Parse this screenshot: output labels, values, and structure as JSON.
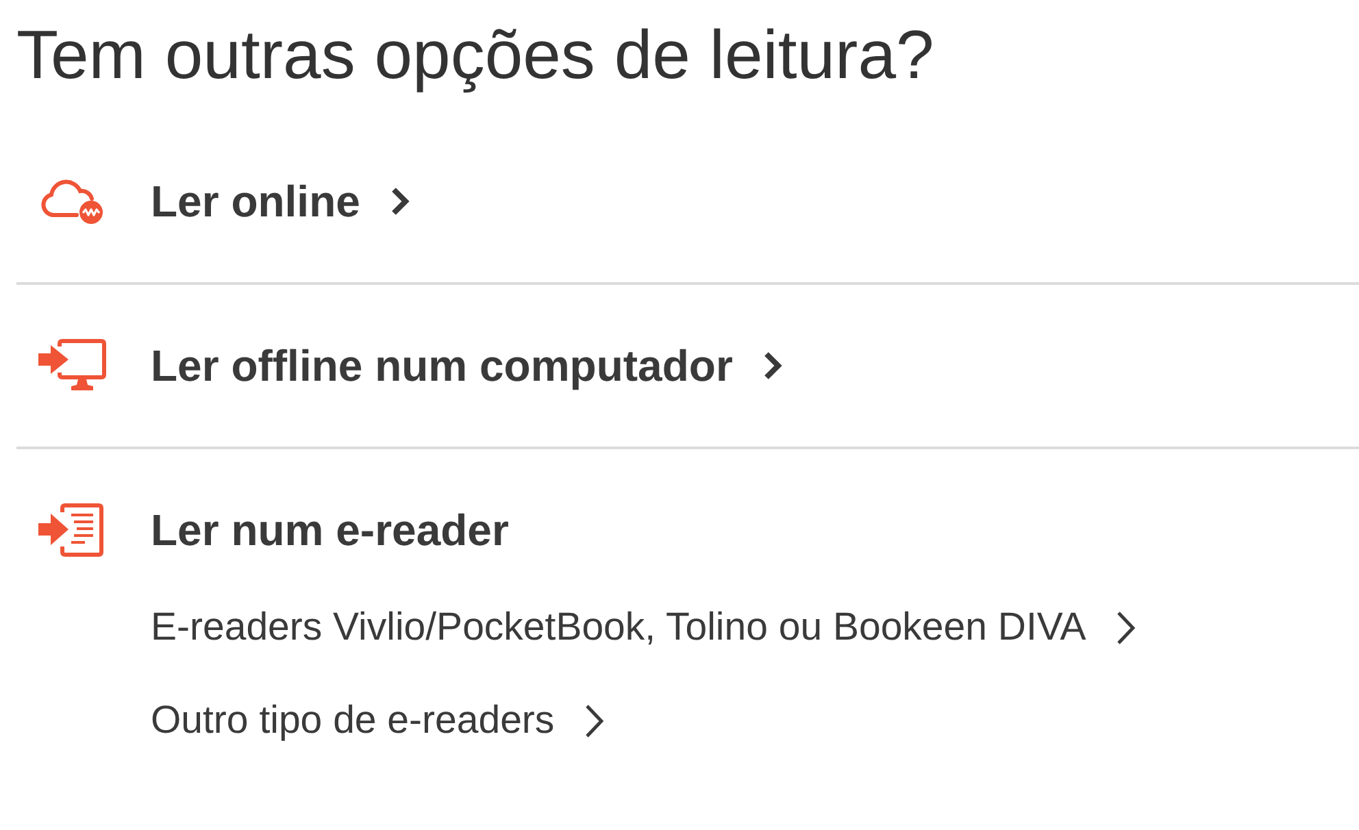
{
  "heading": "Tem outras opções de leitura?",
  "options": [
    {
      "kind": "link",
      "label": "Ler online"
    },
    {
      "kind": "link",
      "label": "Ler offline num computador"
    },
    {
      "kind": "group",
      "label": "Ler num e-reader",
      "links": [
        "E-readers Vivlio/PocketBook, Tolino ou Bookeen DIVA",
        "Outro tipo de e-readers"
      ]
    }
  ]
}
